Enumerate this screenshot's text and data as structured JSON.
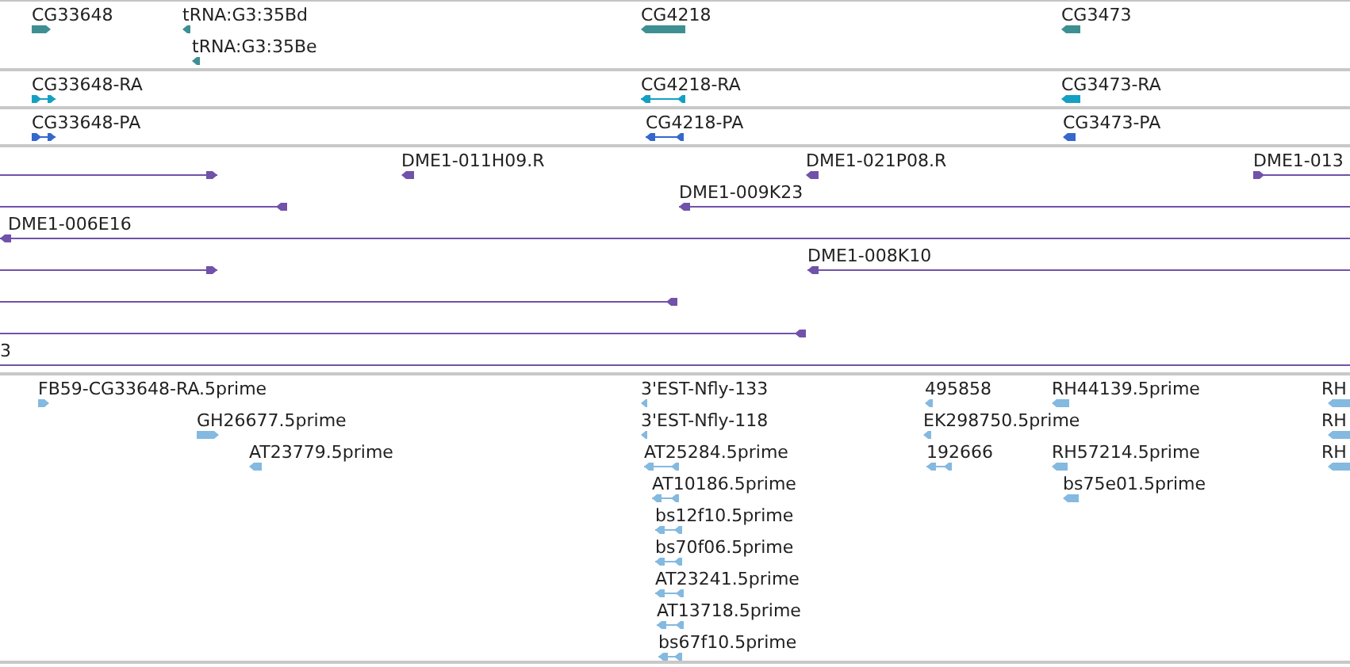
{
  "tracks": [
    {
      "kind": "gene",
      "features": [
        {
          "label": "CG33648",
          "reverse": false
        },
        {
          "label": "tRNA:G3:35Bd",
          "reverse": true
        },
        {
          "label": "tRNA:G3:35Be",
          "reverse": true
        },
        {
          "label": "CG4218",
          "reverse": true
        },
        {
          "label": "CG3473",
          "reverse": true
        }
      ]
    },
    {
      "kind": "transcript",
      "features": [
        {
          "label": "CG33648-RA",
          "reverse": false
        },
        {
          "label": "CG4218-RA",
          "reverse": true
        },
        {
          "label": "CG3473-RA",
          "reverse": true
        }
      ]
    },
    {
      "kind": "protein",
      "features": [
        {
          "label": "CG33648-PA",
          "reverse": false
        },
        {
          "label": "CG4218-PA",
          "reverse": true
        },
        {
          "label": "CG3473-PA",
          "reverse": true
        }
      ]
    },
    {
      "kind": "clone",
      "features": [
        {
          "reverse": false
        },
        {
          "label": "DME1-011H09.R",
          "reverse": true
        },
        {
          "label": "DME1-021P08.R",
          "reverse": true
        },
        {
          "label": "DME1-013",
          "reverse": false
        },
        {
          "reverse": true
        },
        {
          "label": "DME1-009K23",
          "reverse": true
        },
        {
          "label": "DME1-006E16",
          "reverse": true
        },
        {
          "reverse": false
        },
        {
          "label": "DME1-008K10",
          "reverse": true
        },
        {
          "reverse": true
        },
        {
          "reverse": true
        },
        {
          "label": "3"
        }
      ]
    },
    {
      "kind": "est",
      "features": [
        {
          "label": "FB59-CG33648-RA.5prime",
          "reverse": false
        },
        {
          "label": "GH26677.5prime",
          "reverse": false
        },
        {
          "label": "AT23779.5prime",
          "reverse": true
        },
        {
          "label": "3'EST-Nfly-133",
          "reverse": true
        },
        {
          "label": "3'EST-Nfly-118",
          "reverse": true
        },
        {
          "label": "AT25284.5prime",
          "reverse": true
        },
        {
          "label": "AT10186.5prime",
          "reverse": true
        },
        {
          "label": "bs12f10.5prime",
          "reverse": true
        },
        {
          "label": "bs70f06.5prime",
          "reverse": true
        },
        {
          "label": "AT23241.5prime",
          "reverse": true
        },
        {
          "label": "AT13718.5prime",
          "reverse": true
        },
        {
          "label": "bs67f10.5prime",
          "reverse": true
        },
        {
          "label": "495858",
          "reverse": true
        },
        {
          "label": "EK298750.5prime",
          "reverse": true
        },
        {
          "label": "192666",
          "reverse": true
        },
        {
          "label": "RH44139.5prime",
          "reverse": true
        },
        {
          "label": "RH57214.5prime",
          "reverse": true
        },
        {
          "label": "bs75e01.5prime",
          "reverse": true
        },
        {
          "label": "RH",
          "reverse": true
        },
        {
          "label": "RH",
          "reverse": true
        },
        {
          "label": "RH",
          "reverse": true
        }
      ]
    }
  ]
}
